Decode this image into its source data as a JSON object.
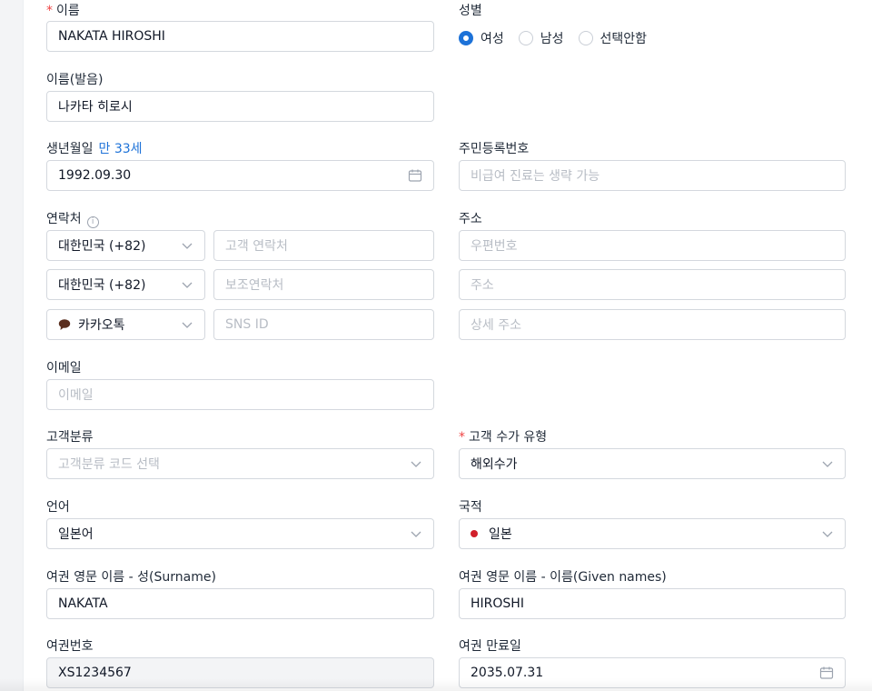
{
  "left": {
    "name": {
      "label": "이름",
      "value": "NAKATA HIROSHI"
    },
    "name_pronunciation": {
      "label": "이름(발음)",
      "value": "나카타 히로시"
    },
    "birthdate": {
      "label": "생년월일",
      "age": "만 33세",
      "value": "1992.09.30"
    },
    "contact": {
      "label": "연락처",
      "info_glyph": "i",
      "primary": {
        "country": "대한민국 (+82)",
        "placeholder": "고객 연락처"
      },
      "secondary": {
        "country": "대한민국 (+82)",
        "placeholder": "보조연락처"
      },
      "messenger": {
        "type": "카카오톡",
        "placeholder": "SNS ID"
      }
    },
    "email": {
      "label": "이메일",
      "placeholder": "이메일"
    },
    "customer_category": {
      "label": "고객분류",
      "placeholder": "고객분류 코드 선택"
    },
    "language": {
      "label": "언어",
      "value": "일본어"
    },
    "passport_surname": {
      "label": "여권 영문 이름 - 성(Surname)",
      "value": "NAKATA"
    },
    "passport_number": {
      "label": "여권번호",
      "value": "XS1234567"
    }
  },
  "right": {
    "gender": {
      "label": "성별",
      "options": [
        "여성",
        "남성",
        "선택안함"
      ],
      "selected": "여성"
    },
    "resident_number": {
      "label": "주민등록번호",
      "placeholder": "비급여 진료는 생략 가능"
    },
    "address": {
      "label": "주소",
      "postal_placeholder": "우편번호",
      "address_placeholder": "주소",
      "detail_placeholder": "상세 주소"
    },
    "fee_type": {
      "label": "고객 수가 유형",
      "value": "해외수가"
    },
    "nationality": {
      "label": "국적",
      "value": "일본",
      "flag_color": "#d11f2a"
    },
    "passport_given": {
      "label": "여권 영문 이름 - 이름(Given names)",
      "value": "HIROSHI"
    },
    "passport_expiry": {
      "label": "여권 만료일",
      "value": "2035.07.31"
    }
  },
  "colors": {
    "accent": "#1d72d8",
    "required": "#ef4444",
    "border": "#d4d8de",
    "placeholder": "#b8bdc5"
  },
  "icons": {
    "select": "chevron-down-icon",
    "date": "calendar-icon",
    "messenger": "chat-bubble-icon",
    "info": "info-icon",
    "nationality": "flag-dot-icon"
  }
}
